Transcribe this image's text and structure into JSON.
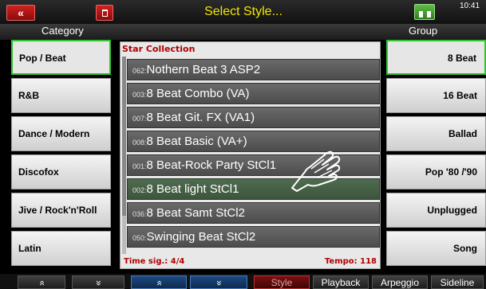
{
  "header": {
    "back_label": "«",
    "title": "Select Style...",
    "clock": "10:41",
    "registration_icon": "registration-icon",
    "trash_icon": "trash-icon"
  },
  "category": {
    "heading": "Category",
    "items": [
      {
        "label": "Pop / Beat",
        "active": true
      },
      {
        "label": "R&B"
      },
      {
        "label": "Dance / Modern"
      },
      {
        "label": "Discofox"
      },
      {
        "label": "Jive / Rock'n'Roll"
      },
      {
        "label": "Latin"
      }
    ]
  },
  "group": {
    "heading": "Group",
    "items": [
      {
        "label": "8 Beat",
        "active": true
      },
      {
        "label": "16 Beat"
      },
      {
        "label": "Ballad"
      },
      {
        "label": "Pop '80 /'90"
      },
      {
        "label": "Unplugged"
      },
      {
        "label": "Song"
      }
    ]
  },
  "list": {
    "heading": "Star Collection",
    "rows": [
      {
        "num": "062:",
        "name": "Nothern Beat 3 ASP2"
      },
      {
        "num": "003:",
        "name": "8 Beat Combo (VA)"
      },
      {
        "num": "007:",
        "name": "8 Beat Git. FX (VA1)"
      },
      {
        "num": "008:",
        "name": "8 Beat Basic (VA+)"
      },
      {
        "num": "001:",
        "name": "8 Beat-Rock Party StCl1"
      },
      {
        "num": "002:",
        "name": "8 Beat light StCl1",
        "selected": true
      },
      {
        "num": "036:",
        "name": "8 Beat Samt StCl2"
      },
      {
        "num": "050:",
        "name": "Swinging Beat StCl2"
      }
    ],
    "time_sig": "Time sig.: 4/4",
    "tempo": "Tempo: 118"
  },
  "bottom": {
    "up1": "»",
    "down1": "»",
    "up2": "»",
    "down2": "»",
    "style": "Style",
    "playback": "Playback",
    "arpeggio": "Arpeggio",
    "sideline": "Sideline"
  },
  "colors": {
    "title": "#f2e600",
    "accent_active": "#2fc52f",
    "panel_red": "#b00000"
  }
}
